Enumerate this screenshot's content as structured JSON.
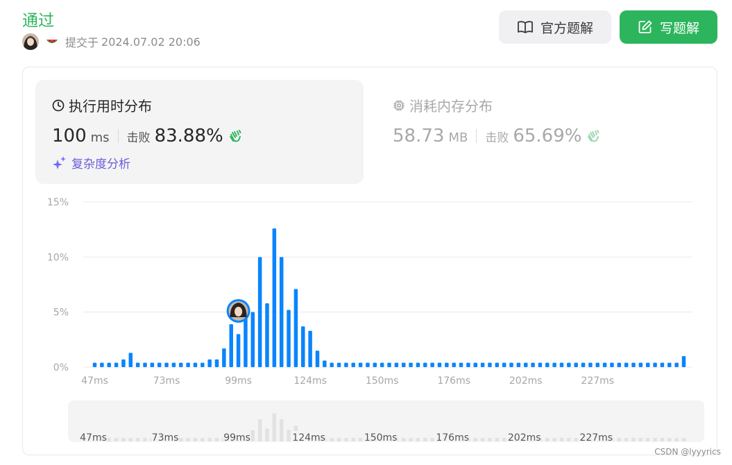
{
  "header": {
    "status": "通过",
    "submitted_prefix": "提交于",
    "submitted_time": "2024.07.02 20:06",
    "official_solution_label": "官方题解",
    "write_solution_label": "写题解"
  },
  "runtime": {
    "title": "执行用时分布",
    "value": "100",
    "unit": "ms",
    "beat_label": "击败",
    "beat_percent": "83.88%",
    "complexity_label": "复杂度分析"
  },
  "memory": {
    "title": "消耗内存分布",
    "value": "58.73",
    "unit": "MB",
    "beat_label": "击败",
    "beat_percent": "65.69%"
  },
  "colors": {
    "accent_green": "#2db55d",
    "bar_blue": "#0a84ff",
    "mini_bar": "#e2e2e2",
    "grid": "#eaeaea"
  },
  "chart_data": {
    "type": "bar",
    "ylim": [
      0,
      15
    ],
    "yticks": [
      "0%",
      "5%",
      "10%",
      "15%"
    ],
    "xtick_labels": [
      "47ms",
      "73ms",
      "99ms",
      "124ms",
      "150ms",
      "176ms",
      "202ms",
      "227ms"
    ],
    "xtick_bar_index": [
      0,
      10,
      20,
      30,
      40,
      50,
      60,
      70
    ],
    "values": [
      0.4,
      0.4,
      0.4,
      0.4,
      0.7,
      1.3,
      0.4,
      0.4,
      0.4,
      0.4,
      0.4,
      0.4,
      0.4,
      0.4,
      0.4,
      0.4,
      0.7,
      0.7,
      1.7,
      3.9,
      3.0,
      4.7,
      5.0,
      10.0,
      5.8,
      12.6,
      10.0,
      5.2,
      7.1,
      3.7,
      3.3,
      1.5,
      0.6,
      0.4,
      0.4,
      0.4,
      0.4,
      0.4,
      0.4,
      0.4,
      0.4,
      0.4,
      0.4,
      0.4,
      0.4,
      0.4,
      0.4,
      0.4,
      0.4,
      0.4,
      0.4,
      0.4,
      0.4,
      0.4,
      0.4,
      0.4,
      0.4,
      0.4,
      0.4,
      0.4,
      0.4,
      0.4,
      0.4,
      0.4,
      0.4,
      0.4,
      0.4,
      0.4,
      0.4,
      0.4,
      0.4,
      0.4,
      0.4,
      0.4,
      0.4,
      0.4,
      0.4,
      0.4,
      0.4,
      0.4,
      0.4,
      0.4,
      1.0
    ],
    "highlight_bar_index": 20,
    "grid": true
  },
  "watermark": "CSDN @lyyyrics"
}
